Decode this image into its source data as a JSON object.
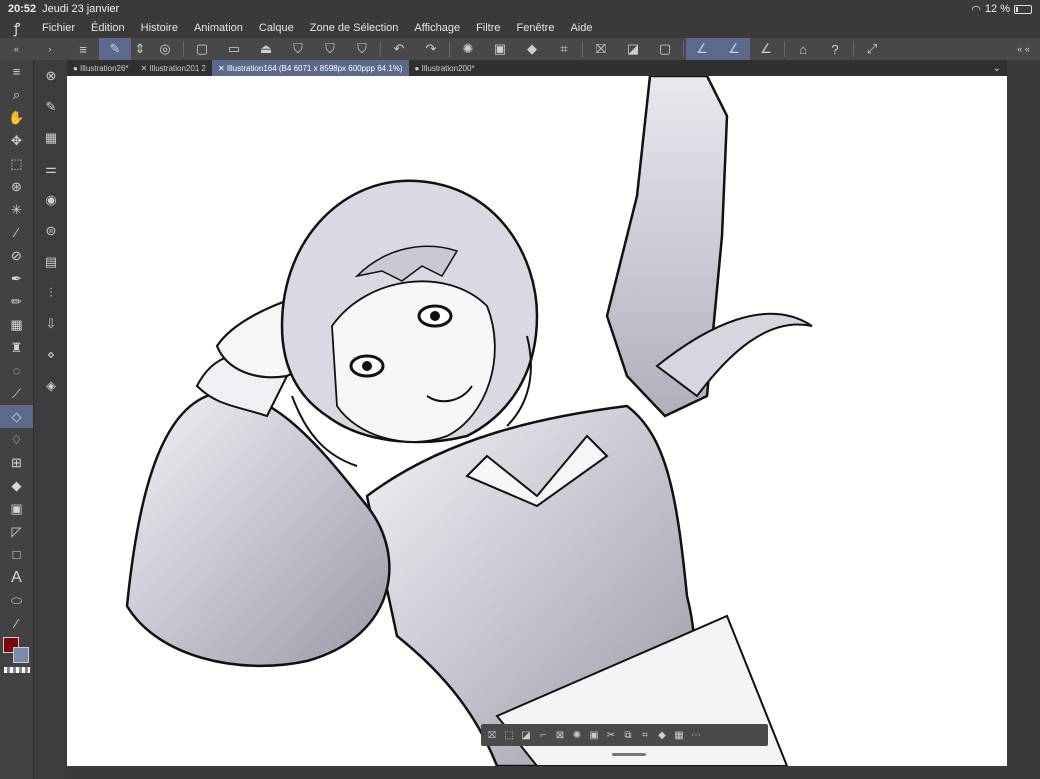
{
  "status": {
    "time": "20:52",
    "date": "Jeudi 23 janvier",
    "battery": "12 %"
  },
  "menu": [
    "Fichier",
    "Édition",
    "Histoire",
    "Animation",
    "Calque",
    "Zone de Sélection",
    "Affichage",
    "Filtre",
    "Fenêtre",
    "Aide"
  ],
  "tabs": [
    {
      "label": "● Illustration26*",
      "active": false
    },
    {
      "label": "✕ Illustration201 2",
      "active": false
    },
    {
      "label": "✕ Illustration164 (B4 6071 x 8598px 600ppp 64.1%)",
      "active": true
    },
    {
      "label": "● Illustration200*",
      "active": false
    }
  ],
  "colors": {
    "main": "#7a0a0a",
    "sub": "#7b8aa8",
    "accent": "#5b6a8a"
  }
}
